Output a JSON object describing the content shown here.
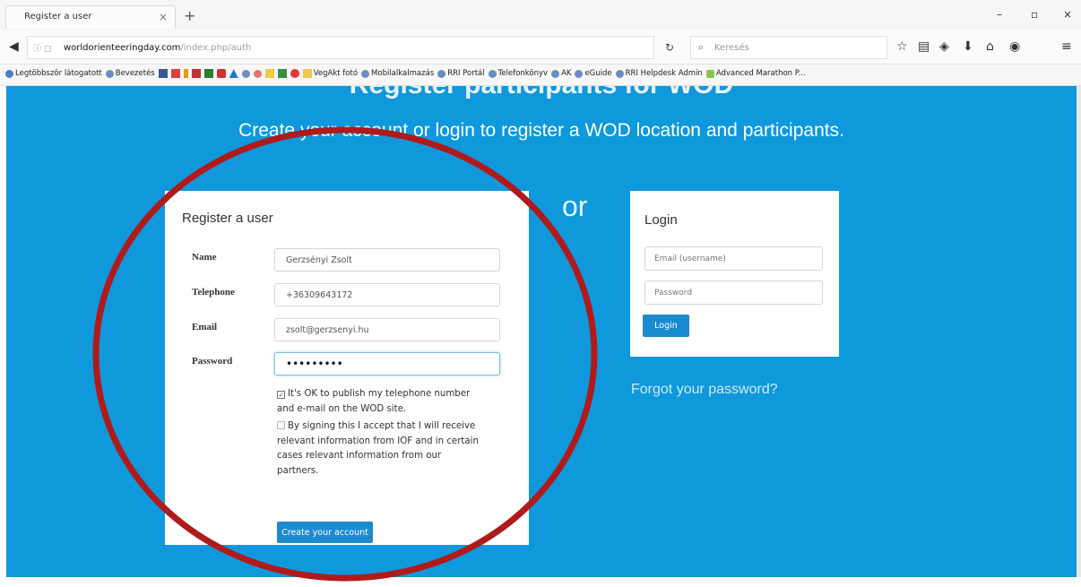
{
  "browser": {
    "tab_title": "Register a user",
    "tab_close": "×",
    "new_tab": "+",
    "window_controls": {
      "minimize": "–",
      "maximize": "▫",
      "close": "×"
    },
    "url_domain": "worldorienteeringday.com",
    "url_path": "/index.php/auth",
    "search_placeholder": "Keresés",
    "bookmarks": [
      "Legtöbbször látogatott",
      "Bevezetés",
      "VegAkt fotó",
      "Mobilalkalmazás",
      "RRI Portál",
      "Telefonkönyv",
      "AK",
      "eGuide",
      "RRI Helpdesk Admin",
      "Advanced Marathon P..."
    ]
  },
  "page": {
    "heading": "Register participants for WOD",
    "subtitle": "Create your account or login to register a WOD location and participants.",
    "or_text": "or"
  },
  "register": {
    "title": "Register a user",
    "fields": {
      "name_label": "Name",
      "name_value": "Gerzsényi Zsolt",
      "telephone_label": "Telephone",
      "telephone_value": "+36309643172",
      "email_label": "Email",
      "email_value": "zsolt@gerzsenyi.hu",
      "password_label": "Password",
      "password_value": "•••••••••"
    },
    "checkbox_publish": "It's OK to publish my telephone number and e-mail on the WOD site.",
    "checkbox_publish_checked": true,
    "checkbox_consent": "By signing this I accept that I will receive relevant information from IOF and in certain cases relevant information from our partners.",
    "checkbox_consent_checked": false,
    "submit_label": "Create your account"
  },
  "login": {
    "title": "Login",
    "email_placeholder": "Email (username)",
    "password_placeholder": "Password",
    "button_label": "Login",
    "forgot_label": "Forgot your password?"
  },
  "colors": {
    "hero_blue": "#0f98dc",
    "button_blue": "#1b8bd0",
    "annotation_red": "#b01a1a"
  }
}
